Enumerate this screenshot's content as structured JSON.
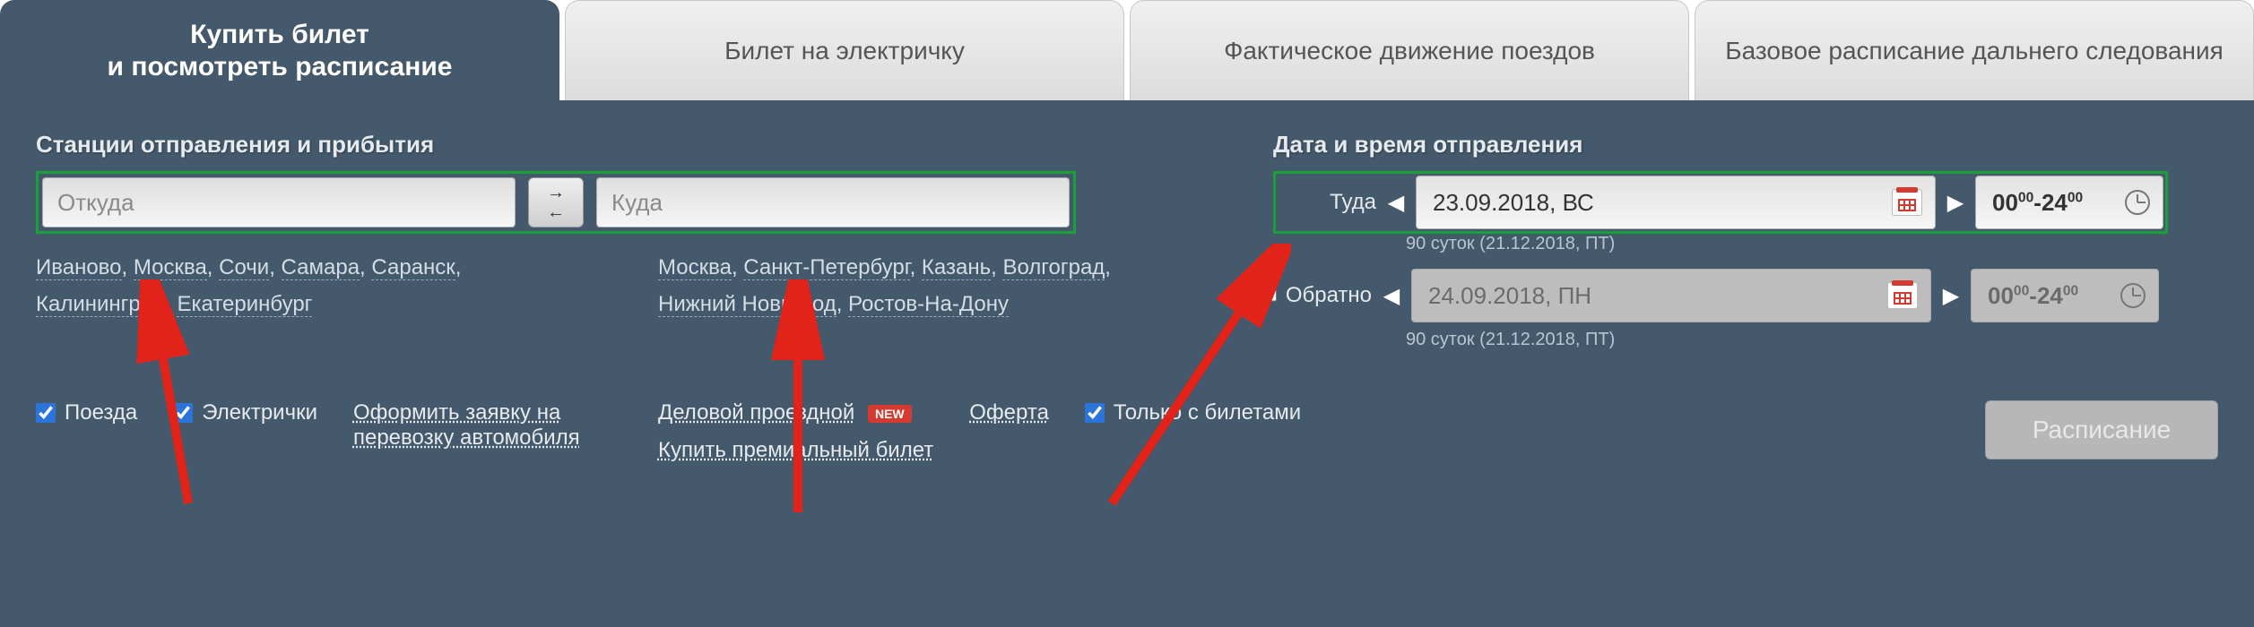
{
  "tabs": {
    "buy": "Купить билет\nи посмотреть расписание",
    "local": "Билет на электричку",
    "actual": "Фактическое движение поездов",
    "schedule": "Базовое расписание дальнего следования"
  },
  "stations": {
    "title": "Станции отправления и прибытия",
    "from_placeholder": "Откуда",
    "to_placeholder": "Куда",
    "from_quick": [
      "Иваново",
      "Москва",
      "Сочи",
      "Самара",
      "Саранск",
      "Калининград",
      "Екатеринбург"
    ],
    "to_quick": [
      "Москва",
      "Санкт-Петербург",
      "Казань",
      "Волгоград",
      "Нижний Новгород",
      "Ростов-На-Дону"
    ]
  },
  "dates": {
    "title": "Дата и время отправления",
    "there_label": "Туда",
    "back_label": "Обратно",
    "there_value": "23.09.2018, ВС",
    "back_value": "24.09.2018, ПН",
    "note": "90 суток (21.12.2018, ПТ)",
    "time_from": "00",
    "time_from_min": "00",
    "time_to": "24",
    "time_to_min": "00"
  },
  "bottom": {
    "trains": "Поезда",
    "local_trains": "Электрички",
    "car_link": "Оформить заявку на перевозку автомобиля",
    "business": "Деловой проездной",
    "premium": "Купить премиальный билет",
    "offer": "Оферта",
    "only_tickets": "Только с билетами",
    "schedule_btn": "Расписание",
    "new_badge": "NEW"
  }
}
